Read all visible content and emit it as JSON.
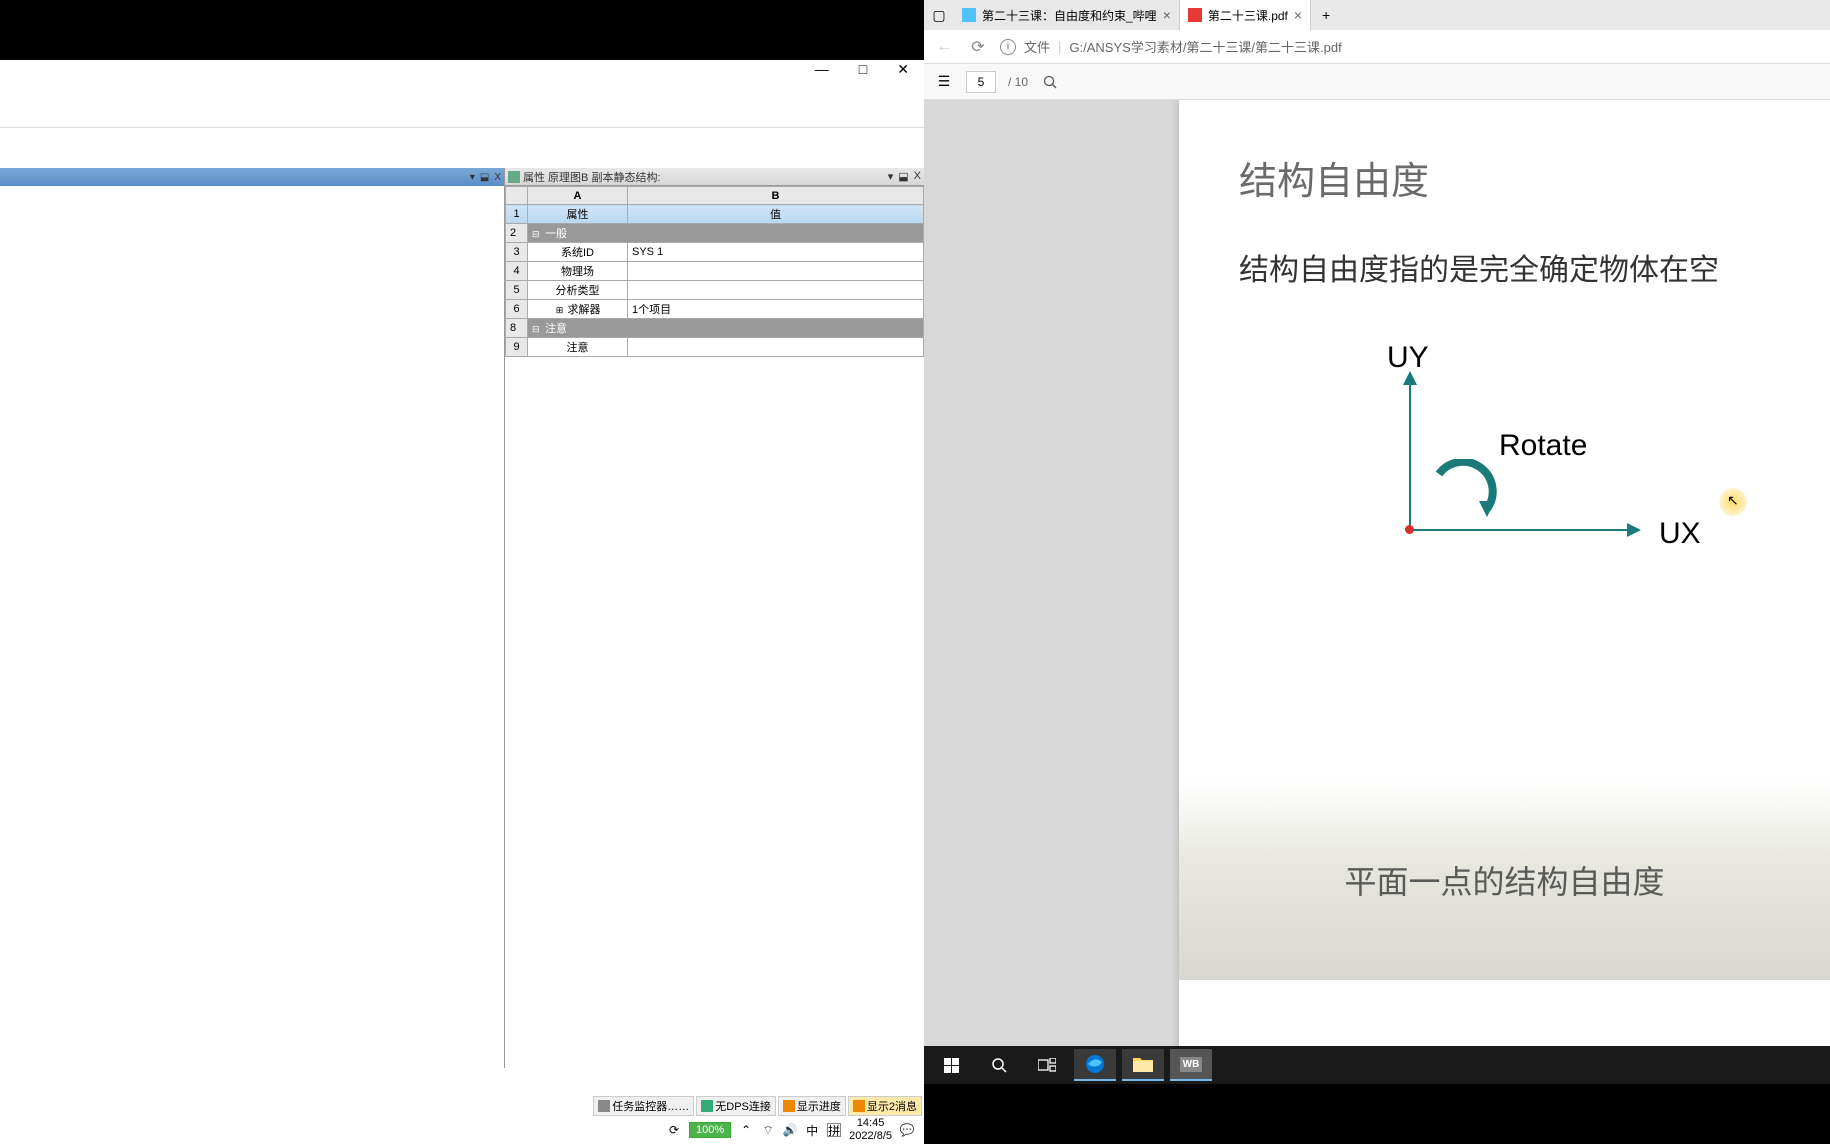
{
  "leftWindow": {
    "controls": {
      "min": "—",
      "max": "□",
      "close": "✕"
    }
  },
  "leftPanelControls": {
    "down": "▾",
    "pin": "⬓",
    "close": "X"
  },
  "propPanel": {
    "title": "属性 原理图B 副本静态结构:",
    "controls": {
      "down": "▾",
      "pin": "⬓",
      "close": "X"
    },
    "cols": {
      "a": "A",
      "b": "B"
    },
    "headerRow": {
      "a": "属性",
      "b": "值"
    },
    "rows": [
      {
        "n": "1",
        "type": "header"
      },
      {
        "n": "2",
        "type": "group",
        "label": "一般",
        "exp": "⊟"
      },
      {
        "n": "3",
        "type": "data",
        "a": "系统ID",
        "b": "SYS 1"
      },
      {
        "n": "4",
        "type": "data",
        "a": "物理场",
        "b": ""
      },
      {
        "n": "5",
        "type": "data",
        "a": "分析类型",
        "b": ""
      },
      {
        "n": "6",
        "type": "data",
        "a": "求解器",
        "b": "1个项目",
        "exp": "⊞"
      },
      {
        "n": "8",
        "type": "group",
        "label": "注意",
        "exp": "⊟"
      },
      {
        "n": "9",
        "type": "data",
        "a": "注意",
        "b": ""
      }
    ]
  },
  "status": {
    "btns": [
      {
        "label": "任务监控器……",
        "iconColor": "#888"
      },
      {
        "label": "无DPS连接",
        "iconColor": "#3a7"
      },
      {
        "label": "显示进度",
        "iconColor": "#e80"
      },
      {
        "label": "显示2消息",
        "iconColor": "#e80",
        "bg": "#ffe9a8"
      }
    ],
    "zoom": "100%",
    "ime": "中",
    "ime2": "拼",
    "time": "14:45",
    "date": "2022/8/5"
  },
  "browser": {
    "tabs": [
      {
        "label": "第二十三课：自由度和约束_哔哩",
        "active": false,
        "fav": "blue"
      },
      {
        "label": "第二十三课.pdf",
        "active": true,
        "fav": "red"
      }
    ],
    "addr": {
      "fileLabel": "文件",
      "path": "G:/ANSYS学习素材/第二十三课/第二十三课.pdf"
    },
    "pdfToolbar": {
      "page": "5",
      "total": "/ 10"
    }
  },
  "pdf": {
    "title": "结构自由度",
    "body": "结构自由度指的是完全确定物体在空",
    "labelUY": "UY",
    "labelUX": "UX",
    "labelRotate": "Rotate",
    "caption": "平面一点的结构自由度"
  }
}
